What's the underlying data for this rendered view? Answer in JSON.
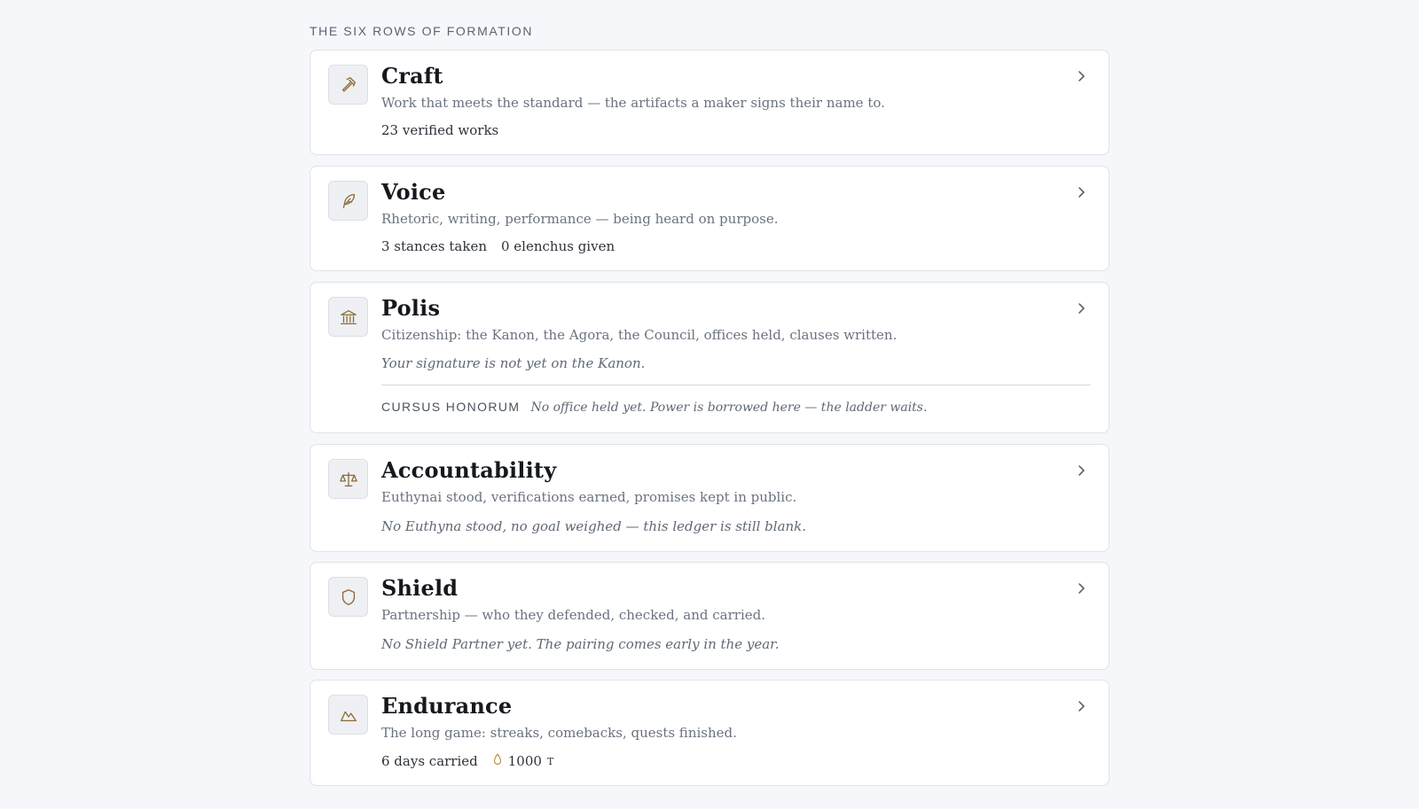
{
  "section_heading": "THE SIX ROWS OF FORMATION",
  "colors": {
    "icon_accent": "#8a6a32",
    "chevron": "#4b5360",
    "card_border": "#dfe2e8"
  },
  "rows": [
    {
      "title": "Craft",
      "icon": "hammer-icon",
      "description": "Work that meets the standard — the artifacts a maker signs their name to.",
      "stats": [
        "23 verified works"
      ]
    },
    {
      "title": "Voice",
      "icon": "quill-icon",
      "description": "Rhetoric, writing, performance — being heard on purpose.",
      "stats": [
        "3 stances taken",
        "0 elenchus given"
      ]
    },
    {
      "title": "Polis",
      "icon": "columns-building-icon",
      "description": "Citizenship: the Kanon, the Agora, the Council, offices held, clauses written.",
      "note": "Your signature is not yet on the Kanon.",
      "cursus_label": "CURSUS HONORUM",
      "cursus_text": "No office held yet. Power is borrowed here — the ladder waits."
    },
    {
      "title": "Accountability",
      "icon": "scales-icon",
      "description": "Euthynai stood, verifications earned, promises kept in public.",
      "note": "No Euthyna stood, no goal weighed — this ledger is still blank."
    },
    {
      "title": "Shield",
      "icon": "shield-icon",
      "description": "Partnership — who they defended, checked, and carried.",
      "note": "No Shield Partner yet. The pairing comes early in the year."
    },
    {
      "title": "Endurance",
      "icon": "mountain-icon",
      "description": "The long game: streaks, comebacks, quests finished.",
      "stats": [
        "6 days carried"
      ],
      "flame_value": "1000",
      "flame_unit": "T"
    }
  ]
}
